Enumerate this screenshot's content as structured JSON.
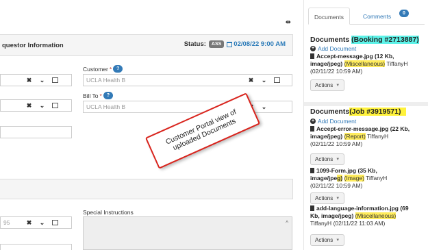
{
  "toolbar": {
    "expand_icon": "expand-arrows-icon",
    "expand_glyph": "⇹"
  },
  "requestor": {
    "title": "questor Information",
    "status_label": "Status:",
    "status_badge": "ASS",
    "status_datetime": "02/08/22 9:00 AM"
  },
  "fields": {
    "customer_label": "Customer",
    "customer_help": "?",
    "customer_value": "UCLA Health B",
    "bill_to_label": "Bill To",
    "bill_to_help": "?",
    "bill_to_value": "UCLA Health B",
    "left_partial_value": "95",
    "special_instructions_label": "Special Instructions"
  },
  "controls": {
    "clear_glyph": "✖",
    "dropdown_glyph": "⌄",
    "scroll_up_glyph": "^"
  },
  "side": {
    "tabs": [
      {
        "label": "Documents"
      },
      {
        "label": "Comments",
        "badge": "0"
      }
    ],
    "booking": {
      "heading_prefix": "Documents",
      "heading_highlight": "(Booking #2713887)",
      "add_label": "Add Document",
      "docs": [
        {
          "name": "Accept-message.jpg",
          "meta": "(12 Kb, image/jpeg)",
          "category": "(Miscellaneous)",
          "user": "TiffanyH",
          "date": "(02/11/22 10:59 AM)",
          "actions": "Actions"
        }
      ]
    },
    "job": {
      "heading_prefix": "Documents",
      "heading_highlight": "(Job #3919571)",
      "add_label": "Add Document",
      "docs": [
        {
          "name": "Accept-error-message.jpg",
          "meta": "(22 Kb, image/jpeg)",
          "category": "(Report)",
          "user": "TiffanyH",
          "date": "(02/11/22 10:59 AM)",
          "actions": "Actions"
        },
        {
          "name": "1099-Form.jpg",
          "meta_a": "(35 Kb,",
          "meta_b": "image/jpe",
          "meta_hl": "g)",
          "category": "(Image)",
          "user": "TiffanyH",
          "date": "(02/11/22 10:59 AM)",
          "actions": "Actions"
        },
        {
          "name": "add-language-information.jpg",
          "meta_a": "(69",
          "meta_b": "Kb, image/jpeg)",
          "category": "(Miscellaneous)",
          "user": "TiffanyH",
          "date": "(02/11/22 11:03 AM)",
          "actions": "Actions"
        }
      ]
    }
  },
  "callout": {
    "text": "Customer Portal view of uploaded Documents"
  },
  "colors": {
    "link_blue": "#337ab7",
    "highlight_cyan": "#5df2e8",
    "highlight_yellow": "#fff23b",
    "callout_border": "#d9241d"
  }
}
